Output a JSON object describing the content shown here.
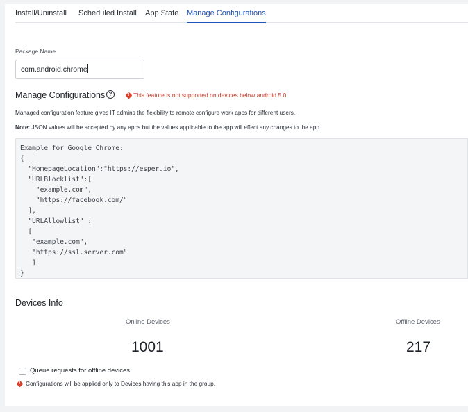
{
  "tabs": [
    {
      "label": "Install/Uninstall",
      "active": false
    },
    {
      "label": "Scheduled Install",
      "active": false
    },
    {
      "label": "App State",
      "active": false
    },
    {
      "label": "Manage Configurations",
      "active": true
    }
  ],
  "package": {
    "label": "Package Name",
    "value": "com.android.chrome"
  },
  "manage_config": {
    "title": "Manage Configurations",
    "help_icon": "help-circle-icon",
    "warning": "This feature is not supported on devices below android 5.0.",
    "description": "Managed configuration feature gives IT admins the flexibility to remote configure work apps for different users.",
    "note_label": "Note:",
    "note_text": " JSON values will be accepted by any apps but the values applicable to the app will effect any changes to the app.",
    "code_lines": [
      "Example for Google Chrome:",
      "{",
      "  \"HomepageLocation\":\"https://esper.io\",",
      "  \"URLBlocklist\":[",
      "    \"example.com\",",
      "    \"https://facebook.com/\"",
      "  ],",
      "  \"URLAllowlist\" :",
      "  [",
      "   \"example.com\",",
      "   \"https://ssl.server.com\"",
      "   ]",
      "}"
    ]
  },
  "devices_info": {
    "title": "Devices Info",
    "online_label": "Online Devices",
    "online_count": "1001",
    "offline_label": "Offline Devices",
    "offline_count": "217",
    "queue_label": "Queue requests for offline devices",
    "queue_checked": false,
    "footer_warning": "Configurations will be applied only to Devices having this app in the group."
  },
  "colors": {
    "accent": "#1f54b8",
    "warning": "#d9402b"
  }
}
